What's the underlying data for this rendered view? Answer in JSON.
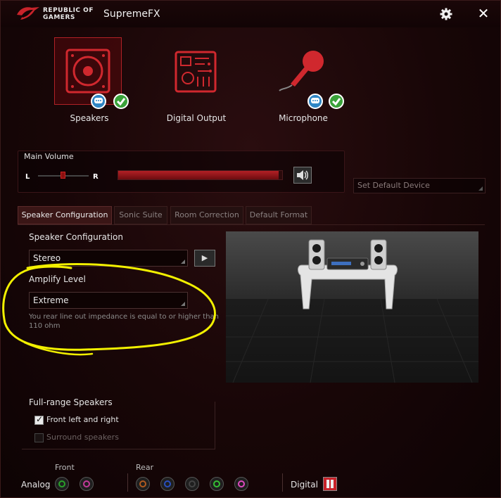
{
  "window": {
    "brand_line1": "REPUBLIC OF",
    "brand_line2": "GAMERS",
    "title": "SupremeFX"
  },
  "devices": [
    {
      "label": "Speakers",
      "selected": true,
      "badges": [
        "chat-icon",
        "check-icon"
      ]
    },
    {
      "label": "Digital Output",
      "selected": false,
      "badges": []
    },
    {
      "label": "Microphone",
      "selected": false,
      "badges": [
        "chat-icon",
        "check-icon"
      ]
    }
  ],
  "volume": {
    "label": "Main Volume",
    "balance_left": "L",
    "balance_right": "R",
    "balance": 0.5,
    "level": 0.98
  },
  "set_default": "Set Default Device",
  "tabs": [
    {
      "label": "Speaker Configuration",
      "active": true
    },
    {
      "label": "Sonic Suite",
      "active": false
    },
    {
      "label": "Room Correction",
      "active": false
    },
    {
      "label": "Default Format",
      "active": false
    }
  ],
  "config": {
    "speaker_config_label": "Speaker Configuration",
    "speaker_config_value": "Stereo",
    "amplify_label": "Amplify Level",
    "amplify_value": "Extreme",
    "note": "You rear line out impedance is equal to or higher than 110 ohm"
  },
  "fullrange": {
    "label": "Full-range Speakers",
    "front": {
      "label": "Front left and right",
      "checked": true,
      "enabled": true
    },
    "surround": {
      "label": "Surround speakers",
      "checked": false,
      "enabled": false
    }
  },
  "jacks": {
    "front_label": "Front",
    "rear_label": "Rear",
    "analog_label": "Analog",
    "digital_label": "Digital",
    "front_colors": [
      "#2aa12a",
      "#c23a9a"
    ],
    "rear_colors": [
      "#b05a20",
      "#2a4fbf",
      "#444444",
      "#35c035",
      "#e04ac0"
    ]
  },
  "colors": {
    "accent_red": "#c8232a",
    "annotation_yellow": "#f2f000"
  }
}
